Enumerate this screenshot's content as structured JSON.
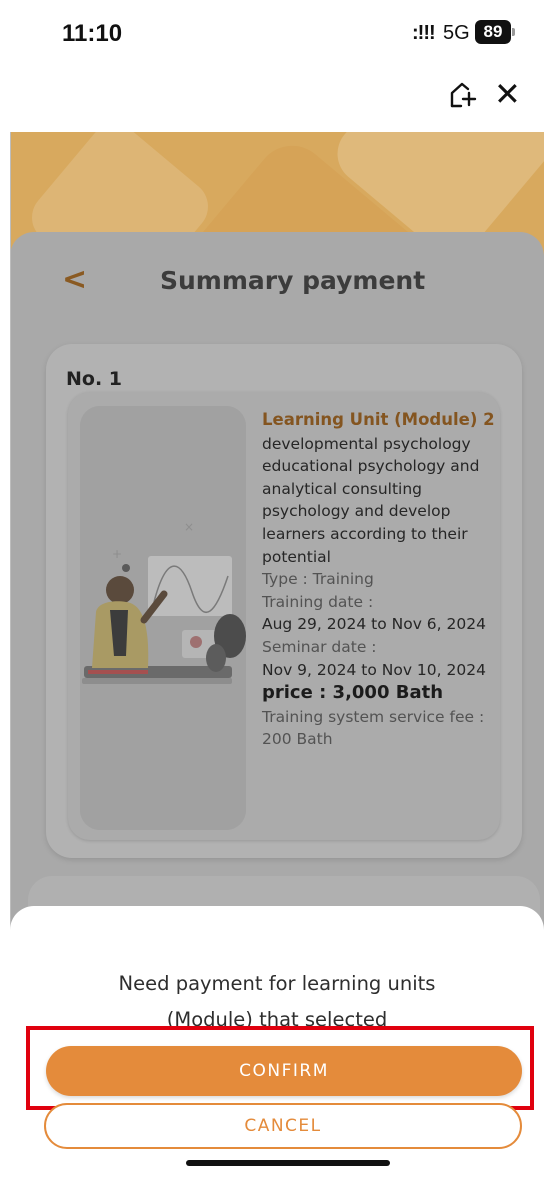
{
  "status_bar": {
    "time": "11:10",
    "signal": ":!!!",
    "network": "5G",
    "battery": "89"
  },
  "top_bar": {
    "add_home_icon": "home-plus-icon",
    "close_icon": "close-icon"
  },
  "header": {
    "back_icon": "chevron-left-icon",
    "title": "Summary payment"
  },
  "card": {
    "number": "No. 1",
    "module_title": "Learning Unit (Module) 2",
    "description": [
      "developmental psychology",
      "educational psychology and",
      "analytical consulting",
      "psychology and develop",
      "learners according to their",
      "potential"
    ],
    "type": "Type : Training",
    "training_date_label": "Training date :",
    "training_date": "Aug 29, 2024 to Nov 6, 2024",
    "seminar_date_label": "Seminar date :",
    "seminar_date": "Nov 9, 2024 to Nov 10, 2024",
    "price": "price : 3,000 Bath",
    "fee_label": "Training system service fee :",
    "fee_value": "200 Bath"
  },
  "sheet": {
    "message_line1": "Need payment for learning units",
    "message_line2": "(Module) that selected",
    "confirm_label": "CONFIRM",
    "cancel_label": "CANCEL"
  },
  "colors": {
    "accent": "#e48b3b",
    "highlight": "#e0000e",
    "title_orange": "#845520"
  }
}
